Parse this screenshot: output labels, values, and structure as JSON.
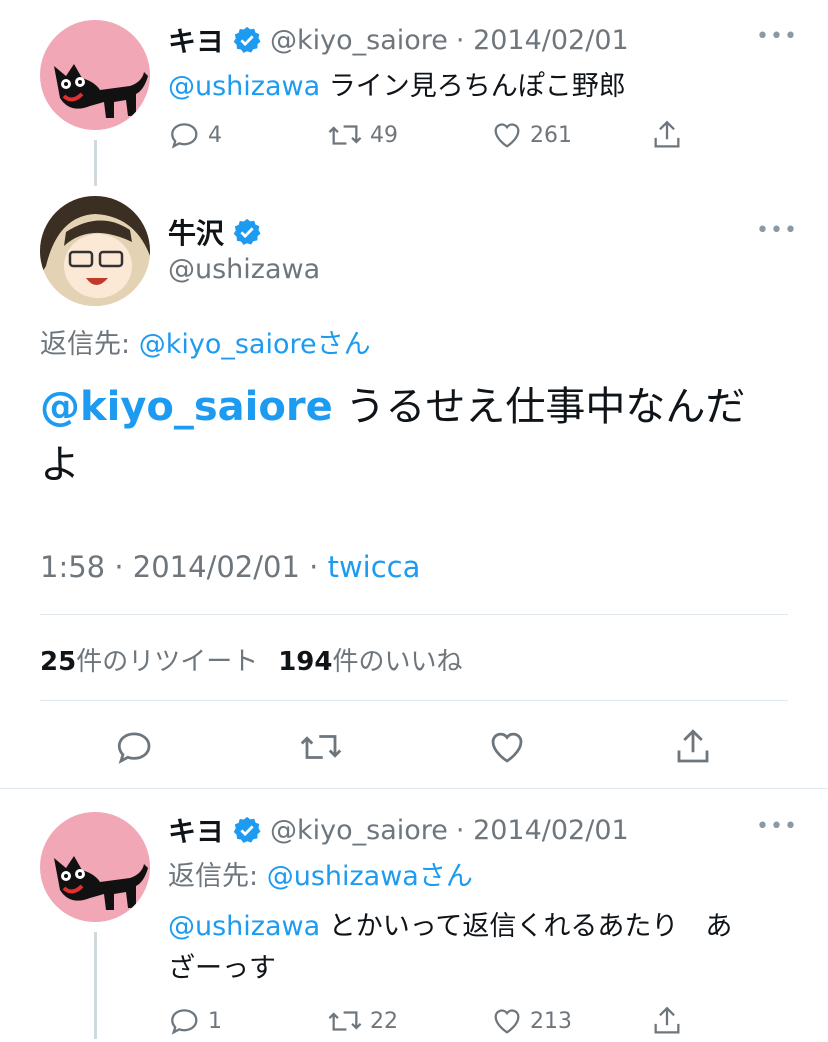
{
  "tweets": [
    {
      "name": "キヨ",
      "handle": "@kiyo_saiore",
      "date": "· 2014/02/01",
      "mention": "@ushizawa",
      "text": " ライン見ろちんぽこ野郎",
      "replies": "4",
      "retweets": "49",
      "likes": "261"
    },
    {
      "name": "キヨ",
      "handle": "@kiyo_saiore",
      "date": "· 2014/02/01",
      "reply_prefix": "返信先:",
      "reply_to": "@ushizawaさん",
      "mention": "@ushizawa",
      "text_line1": " とかいって返信くれるあたり　あ",
      "text_line2": "ざーっす",
      "replies": "1",
      "retweets": "22",
      "likes": "213"
    }
  ],
  "focused": {
    "name": "牛沢",
    "handle": "@ushizawa",
    "reply_prefix": "返信先:",
    "reply_to": "@kiyo_saioreさん",
    "mention": "@kiyo_saiore",
    "text_line1": " うるせえ仕事中なんだ",
    "text_line2": "よ",
    "time": "1:58 · 2014/02/01 · ",
    "source": "twicca",
    "retweet_count": "25",
    "retweet_label": "件のリツイート",
    "like_count": "194",
    "like_label": "件のいいね"
  },
  "more_glyph": "•••",
  "colors": {
    "accent": "#1d9bf0",
    "muted": "#6e767d",
    "avatar_pink": "#f1a7b5"
  }
}
